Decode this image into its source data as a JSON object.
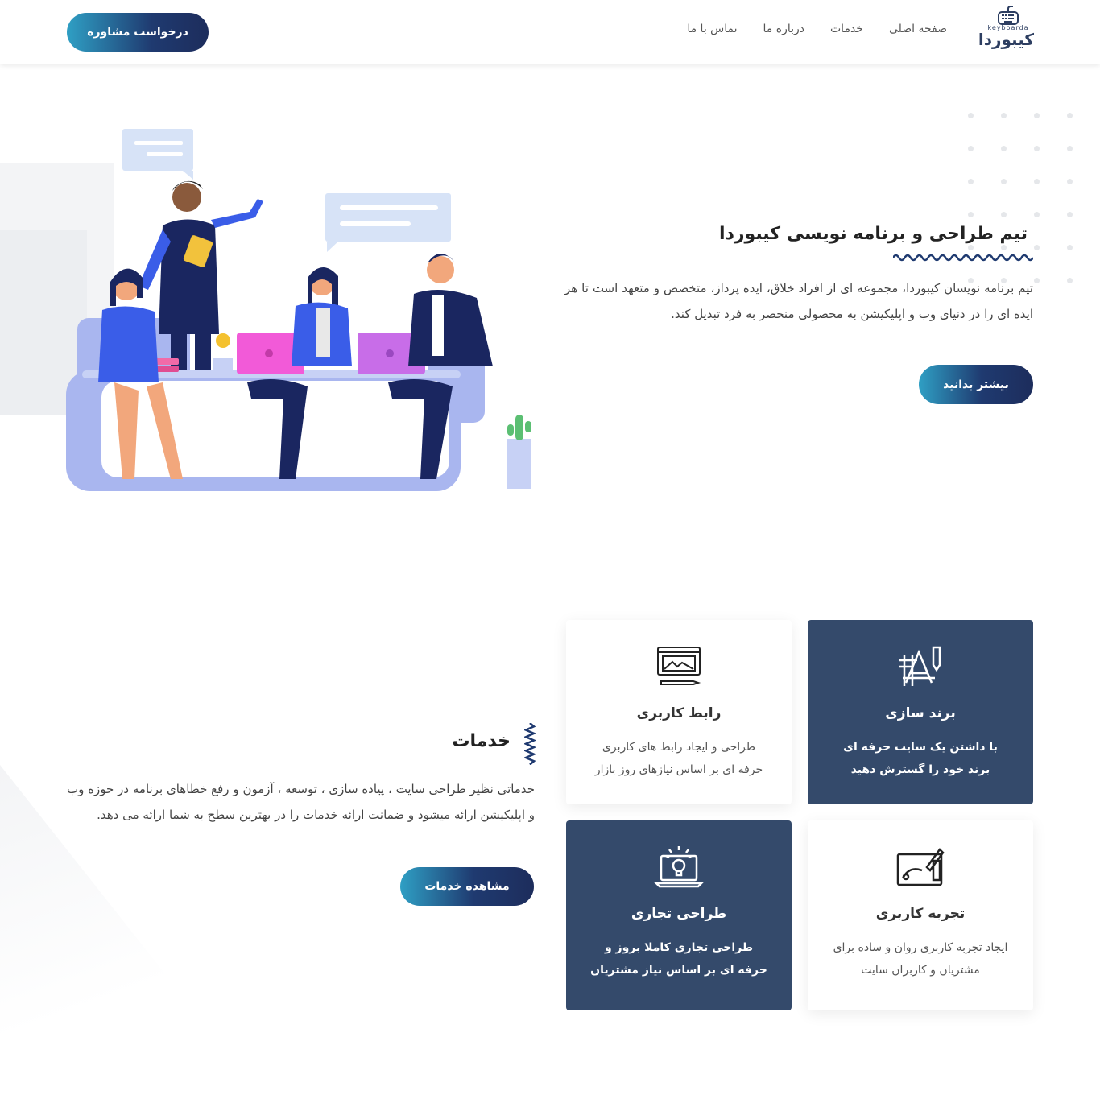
{
  "header": {
    "logo_en": "keyboarda",
    "logo_fa": "کیبوردا",
    "nav": [
      {
        "label": "صفحه اصلی"
      },
      {
        "label": "خدمات"
      },
      {
        "label": "درباره ما"
      },
      {
        "label": "تماس با ما"
      }
    ],
    "cta_label": "درخواست مشاوره"
  },
  "hero": {
    "title": "تیم طراحی و برنامه نویسی کیبوردا",
    "text": "تیم برنامه نویسان کیبوردا، مجموعه ای از افراد خلاق، ایده پرداز، متخصص و متعهد است تا هر ایده ای را در دنیای وب و اپلیکیشن به محصولی منحصر به فرد تبدیل کند.",
    "button_label": "بیشتر بدانید"
  },
  "services": {
    "title": "خدمات",
    "text": "خدماتی نظیر طراحی سایت ، پیاده سازی ، توسعه ، آزمون و رفع خطاهای برنامه در حوزه وب و اپلیکیشن ارائه میشود و ضمانت ارائه خدمات را در بهترین سطح به شما ارائه می دهد.",
    "button_label": "مشاهده خدمات",
    "cards": [
      {
        "title": "برند سازی",
        "desc": "با داشتن یک سایت حرفه ای برند خود را گسترش دهید",
        "icon": "branding-icon"
      },
      {
        "title": "رابط کاربری",
        "desc": "طراحی و ایجاد رابط های کاربری حرفه ای بر اساس نیازهای روز بازار",
        "icon": "ui-design-icon"
      },
      {
        "title": "تجربه کاربری",
        "desc": "ایجاد تجربه کاربری روان و ساده برای مشتریان و کاربران سایت",
        "icon": "ux-tablet-icon"
      },
      {
        "title": "طراحی تجاری",
        "desc": "طراحی تجاری کاملا بروز و حرفه ای بر اساس نیاز مشتریان",
        "icon": "idea-laptop-icon"
      }
    ]
  },
  "colors": {
    "primary": "#1f3a70",
    "accent": "#2f9fc4",
    "card_dark": "#344a6b"
  }
}
